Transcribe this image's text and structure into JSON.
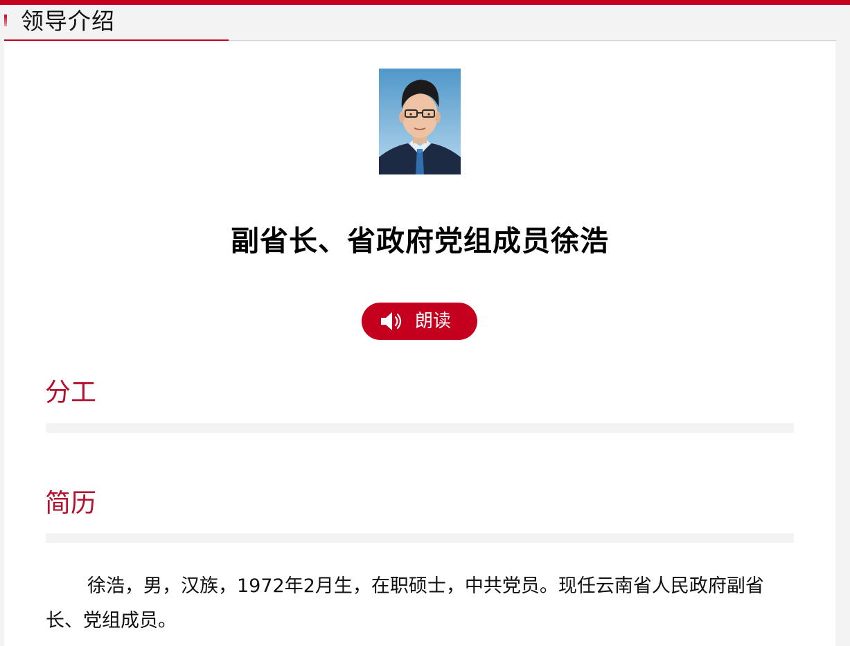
{
  "header": {
    "title": "领导介绍"
  },
  "profile": {
    "title": "副省长、省政府党组成员徐浩",
    "photo_alt": "portrait photo"
  },
  "read_button": {
    "label": "朗读",
    "icon": "speaker-icon"
  },
  "sections": {
    "duty": {
      "heading": "分工"
    },
    "resume": {
      "heading": "简历",
      "text": "徐浩，男，汉族，1972年2月生，在职硕士，中共党员。现任云南省人民政府副省长、党组成员。"
    }
  },
  "colors": {
    "accent": "#c4001e",
    "heading": "#b3112e",
    "background": "#f3f3f3"
  }
}
